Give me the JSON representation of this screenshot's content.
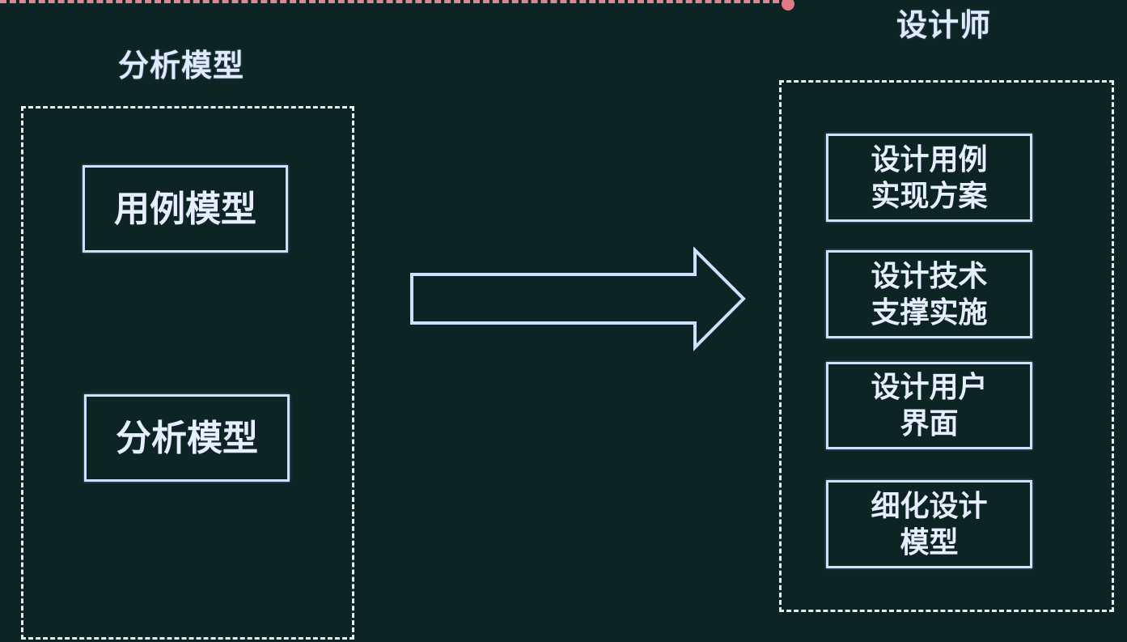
{
  "left_group": {
    "title": "分析模型",
    "items": [
      "用例模型",
      "分析模型"
    ]
  },
  "right_group": {
    "title": "设计师",
    "items": [
      {
        "line1": "设计用例",
        "line2": "实现方案"
      },
      {
        "line1": "设计技术",
        "line2": "支撑实施"
      },
      {
        "line1": "设计用户",
        "line2": "界面"
      },
      {
        "line1": "细化设计",
        "line2": "模型"
      }
    ]
  },
  "colors": {
    "background": "#0d2424",
    "box_border": "#cfe0ff",
    "dashed_frame": "#e6ecf5",
    "top_divider": "#d88a94"
  },
  "icons": {
    "flow_arrow": "right-arrow-outline"
  }
}
